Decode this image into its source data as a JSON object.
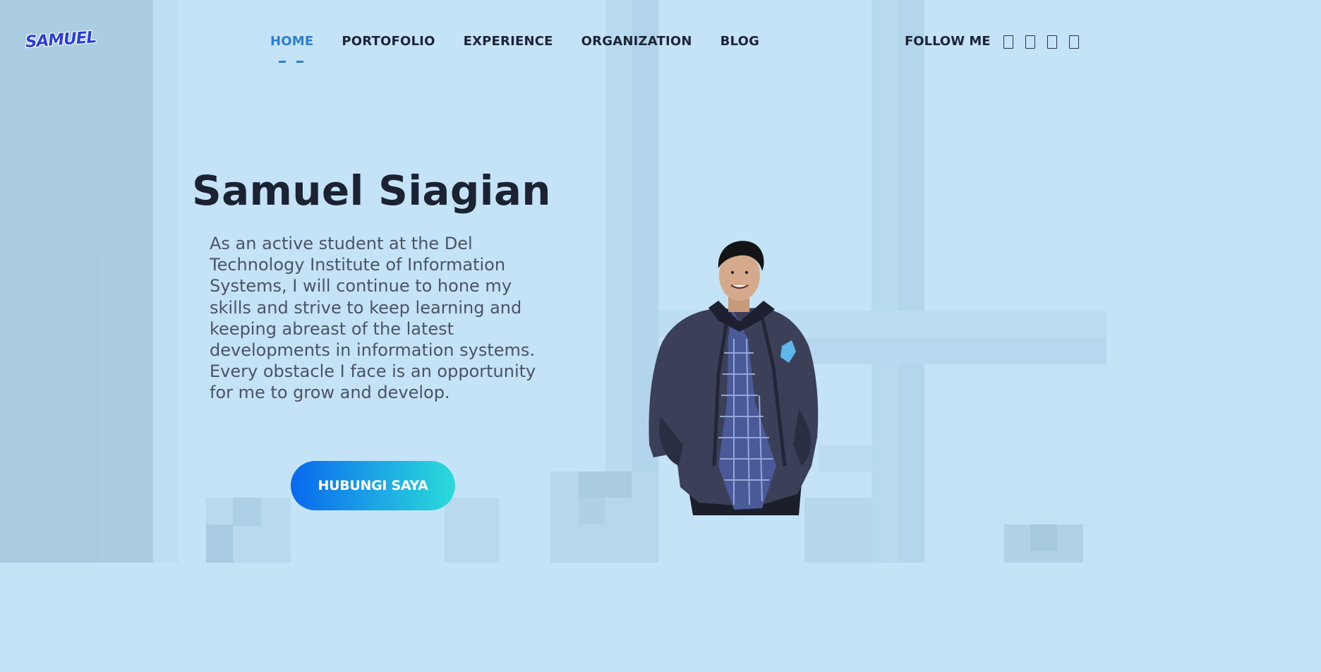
{
  "brand": {
    "logo_text": "SAMUEL"
  },
  "nav": {
    "items": [
      {
        "label": "HOME",
        "active": true
      },
      {
        "label": "PORTOFOLIO",
        "active": false
      },
      {
        "label": "EXPERIENCE",
        "active": false
      },
      {
        "label": "ORGANIZATION",
        "active": false
      },
      {
        "label": "BLOG",
        "active": false
      }
    ]
  },
  "follow": {
    "label": "FOLLOW ME",
    "icons": [
      "instagram-icon",
      "linkedin-icon",
      "github-icon",
      "twitter-icon"
    ]
  },
  "hero": {
    "title": "Samuel Siagian",
    "description": "As an active student at the Del Technology Institute of Information Systems, I will continue to hone my skills and strive to keep learning and keeping abreast of the latest developments in information systems. Every obstacle I face is an opportunity for me to grow and develop.",
    "cta_label": "HUBUNGI SAYA"
  },
  "colors": {
    "background": "#c4e3f6",
    "accent": "#2f7fd0",
    "text_dark": "#1b2333",
    "text_muted": "#4a5463",
    "button_gradient_start": "#0868ee",
    "button_gradient_end": "#2adbd9"
  }
}
